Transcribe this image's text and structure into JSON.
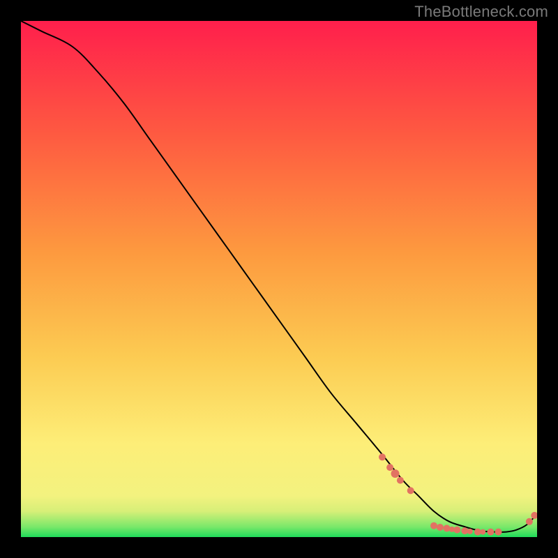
{
  "watermark": "TheBottleneck.com",
  "chart_data": {
    "type": "line",
    "title": "",
    "xlabel": "",
    "ylabel": "",
    "xlim": [
      0,
      100
    ],
    "ylim": [
      0,
      100
    ],
    "background_gradient": {
      "stops": [
        {
          "y": 0,
          "color": "#1fdc5a"
        },
        {
          "y": 2,
          "color": "#7be86a"
        },
        {
          "y": 5,
          "color": "#d7ef78"
        },
        {
          "y": 8,
          "color": "#f3f27f"
        },
        {
          "y": 18,
          "color": "#fdee78"
        },
        {
          "y": 35,
          "color": "#fccb52"
        },
        {
          "y": 55,
          "color": "#fd9a3f"
        },
        {
          "y": 78,
          "color": "#fe5a41"
        },
        {
          "y": 100,
          "color": "#ff1f4c"
        }
      ]
    },
    "series": [
      {
        "name": "bottleneck-curve",
        "x": [
          0,
          4,
          10,
          15,
          20,
          25,
          30,
          35,
          40,
          45,
          50,
          55,
          60,
          65,
          70,
          74,
          77,
          80,
          83,
          86,
          89,
          92,
          94,
          96,
          98,
          100
        ],
        "y": [
          100,
          98,
          95,
          90,
          84,
          77,
          70,
          63,
          56,
          49,
          42,
          35,
          28,
          22,
          16,
          11,
          8,
          5,
          3,
          2,
          1.2,
          1,
          1,
          1.4,
          2.4,
          4.5
        ]
      }
    ],
    "markers": {
      "name": "highlighted-points",
      "color": "#e27262",
      "points": [
        {
          "x": 70.0,
          "y": 15.5,
          "r": 5
        },
        {
          "x": 71.5,
          "y": 13.5,
          "r": 5
        },
        {
          "x": 72.5,
          "y": 12.3,
          "r": 6
        },
        {
          "x": 73.5,
          "y": 11.0,
          "r": 5
        },
        {
          "x": 75.5,
          "y": 9.0,
          "r": 5
        },
        {
          "x": 80.0,
          "y": 2.2,
          "r": 5
        },
        {
          "x": 81.2,
          "y": 1.9,
          "r": 5
        },
        {
          "x": 82.5,
          "y": 1.7,
          "r": 5
        },
        {
          "x": 83.5,
          "y": 1.5,
          "r": 4
        },
        {
          "x": 84.5,
          "y": 1.4,
          "r": 5
        },
        {
          "x": 86.0,
          "y": 1.2,
          "r": 5
        },
        {
          "x": 87.0,
          "y": 1.1,
          "r": 4
        },
        {
          "x": 88.5,
          "y": 1.0,
          "r": 5
        },
        {
          "x": 89.5,
          "y": 1.0,
          "r": 4
        },
        {
          "x": 91.0,
          "y": 1.0,
          "r": 5
        },
        {
          "x": 92.5,
          "y": 1.0,
          "r": 5
        },
        {
          "x": 98.5,
          "y": 3.0,
          "r": 5
        },
        {
          "x": 99.5,
          "y": 4.2,
          "r": 5
        }
      ]
    }
  }
}
